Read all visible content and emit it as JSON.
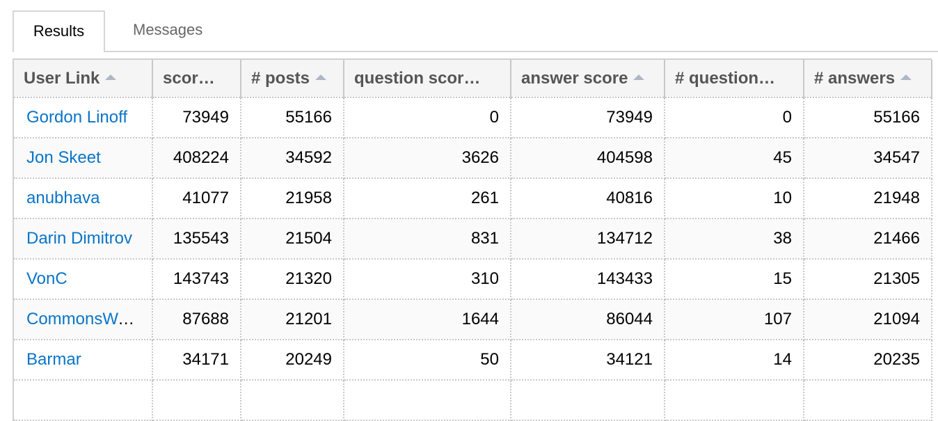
{
  "tabs": [
    {
      "label": "Results",
      "active": true
    },
    {
      "label": "Messages",
      "active": false
    }
  ],
  "columns": [
    {
      "label": "User Link",
      "sort_icon": "sort-asc-icon"
    },
    {
      "label": "scor…",
      "sort_icon": null
    },
    {
      "label": "# posts",
      "sort_icon": "sort-asc-icon"
    },
    {
      "label": "question scor…",
      "sort_icon": null
    },
    {
      "label": "answer score",
      "sort_icon": "sort-asc-icon"
    },
    {
      "label": "# question…",
      "sort_icon": null
    },
    {
      "label": "# answers",
      "sort_icon": "sort-asc-icon"
    }
  ],
  "rows": [
    {
      "user": "Gordon Linoff",
      "score": "73949",
      "posts": "55166",
      "question_score": "0",
      "answer_score": "73949",
      "questions": "0",
      "answers": "55166"
    },
    {
      "user": "Jon Skeet",
      "score": "408224",
      "posts": "34592",
      "question_score": "3626",
      "answer_score": "404598",
      "questions": "45",
      "answers": "34547"
    },
    {
      "user": "anubhava",
      "score": "41077",
      "posts": "21958",
      "question_score": "261",
      "answer_score": "40816",
      "questions": "10",
      "answers": "21948"
    },
    {
      "user": "Darin Dimitrov",
      "score": "135543",
      "posts": "21504",
      "question_score": "831",
      "answer_score": "134712",
      "questions": "38",
      "answers": "21466"
    },
    {
      "user": "VonC",
      "score": "143743",
      "posts": "21320",
      "question_score": "310",
      "answer_score": "143433",
      "questions": "15",
      "answers": "21305"
    },
    {
      "user": "CommonsWare",
      "score": "87688",
      "posts": "21201",
      "question_score": "1644",
      "answer_score": "86044",
      "questions": "107",
      "answers": "21094"
    },
    {
      "user": "Barmar",
      "score": "34171",
      "posts": "20249",
      "question_score": "50",
      "answer_score": "34121",
      "questions": "14",
      "answers": "20235"
    }
  ],
  "colors": {
    "link": "#0a74c8",
    "header_text": "#555555",
    "header_bg": "#f5f5f5"
  }
}
